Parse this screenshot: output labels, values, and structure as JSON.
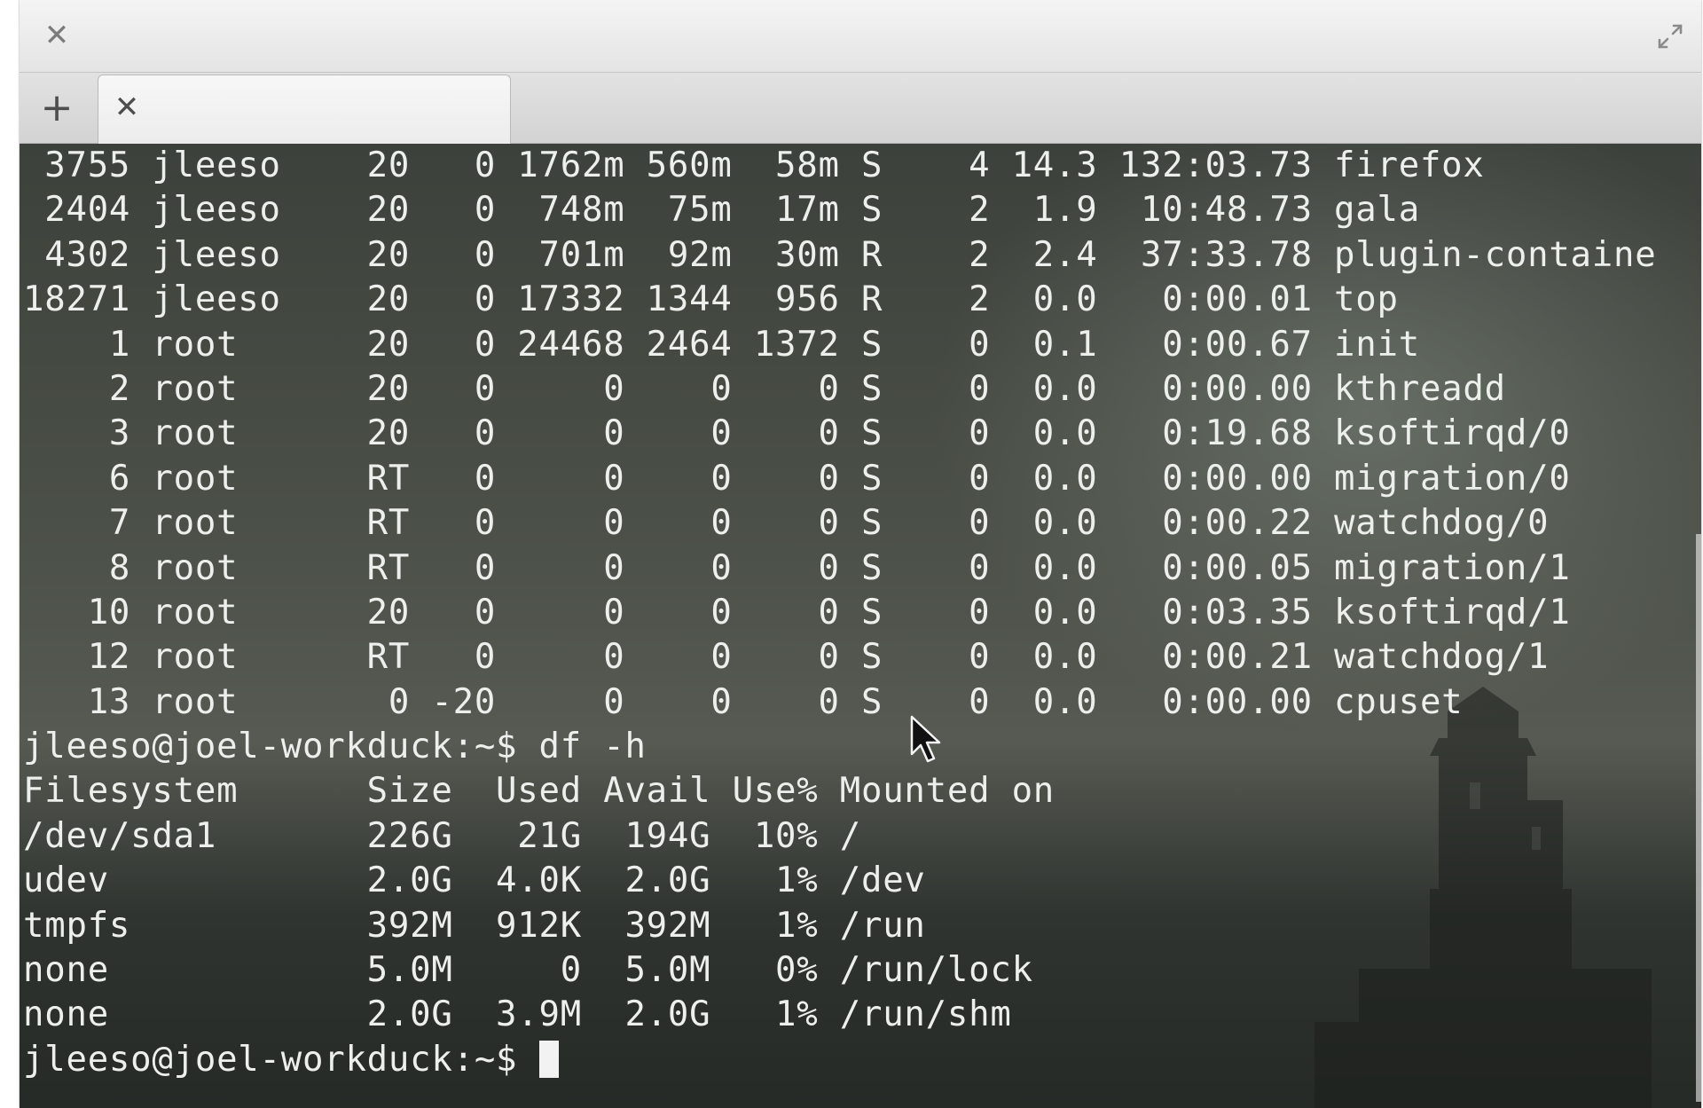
{
  "window": {
    "title": "",
    "close_icon": "close-icon",
    "maximize_icon": "maximize-icon"
  },
  "tabs": [
    {
      "label": "",
      "close_icon": "close-icon"
    }
  ],
  "new_tab_icon": "plus-icon",
  "terminal": {
    "lines": [
      " 3755 jleeso    20   0 1762m 560m  58m S    4 14.3 132:03.73 firefox",
      " 2404 jleeso    20   0  748m  75m  17m S    2  1.9  10:48.73 gala",
      " 4302 jleeso    20   0  701m  92m  30m R    2  2.4  37:33.78 plugin-containe",
      "18271 jleeso    20   0 17332 1344  956 R    2  0.0   0:00.01 top",
      "    1 root      20   0 24468 2464 1372 S    0  0.1   0:00.67 init",
      "    2 root      20   0     0    0    0 S    0  0.0   0:00.00 kthreadd",
      "    3 root      20   0     0    0    0 S    0  0.0   0:19.68 ksoftirqd/0",
      "    6 root      RT   0     0    0    0 S    0  0.0   0:00.00 migration/0",
      "    7 root      RT   0     0    0    0 S    0  0.0   0:00.22 watchdog/0",
      "    8 root      RT   0     0    0    0 S    0  0.0   0:00.05 migration/1",
      "   10 root      20   0     0    0    0 S    0  0.0   0:03.35 ksoftirqd/1",
      "   12 root      RT   0     0    0    0 S    0  0.0   0:00.21 watchdog/1",
      "   13 root       0 -20     0    0    0 S    0  0.0   0:00.00 cpuset",
      "jleeso@joel-workduck:~$ df -h",
      "Filesystem      Size  Used Avail Use% Mounted on",
      "/dev/sda1       226G   21G  194G  10% /",
      "udev            2.0G  4.0K  2.0G   1% /dev",
      "tmpfs           392M  912K  392M   1% /run",
      "none            5.0M     0  5.0M   0% /run/lock",
      "none            2.0G  3.9M  2.0G   1% /run/shm"
    ],
    "prompt": "jleeso@joel-workduck:~$ ",
    "text_color": "#ecefec",
    "background_color": "#2b302c"
  },
  "pointer_icon": "mouse-pointer-icon"
}
